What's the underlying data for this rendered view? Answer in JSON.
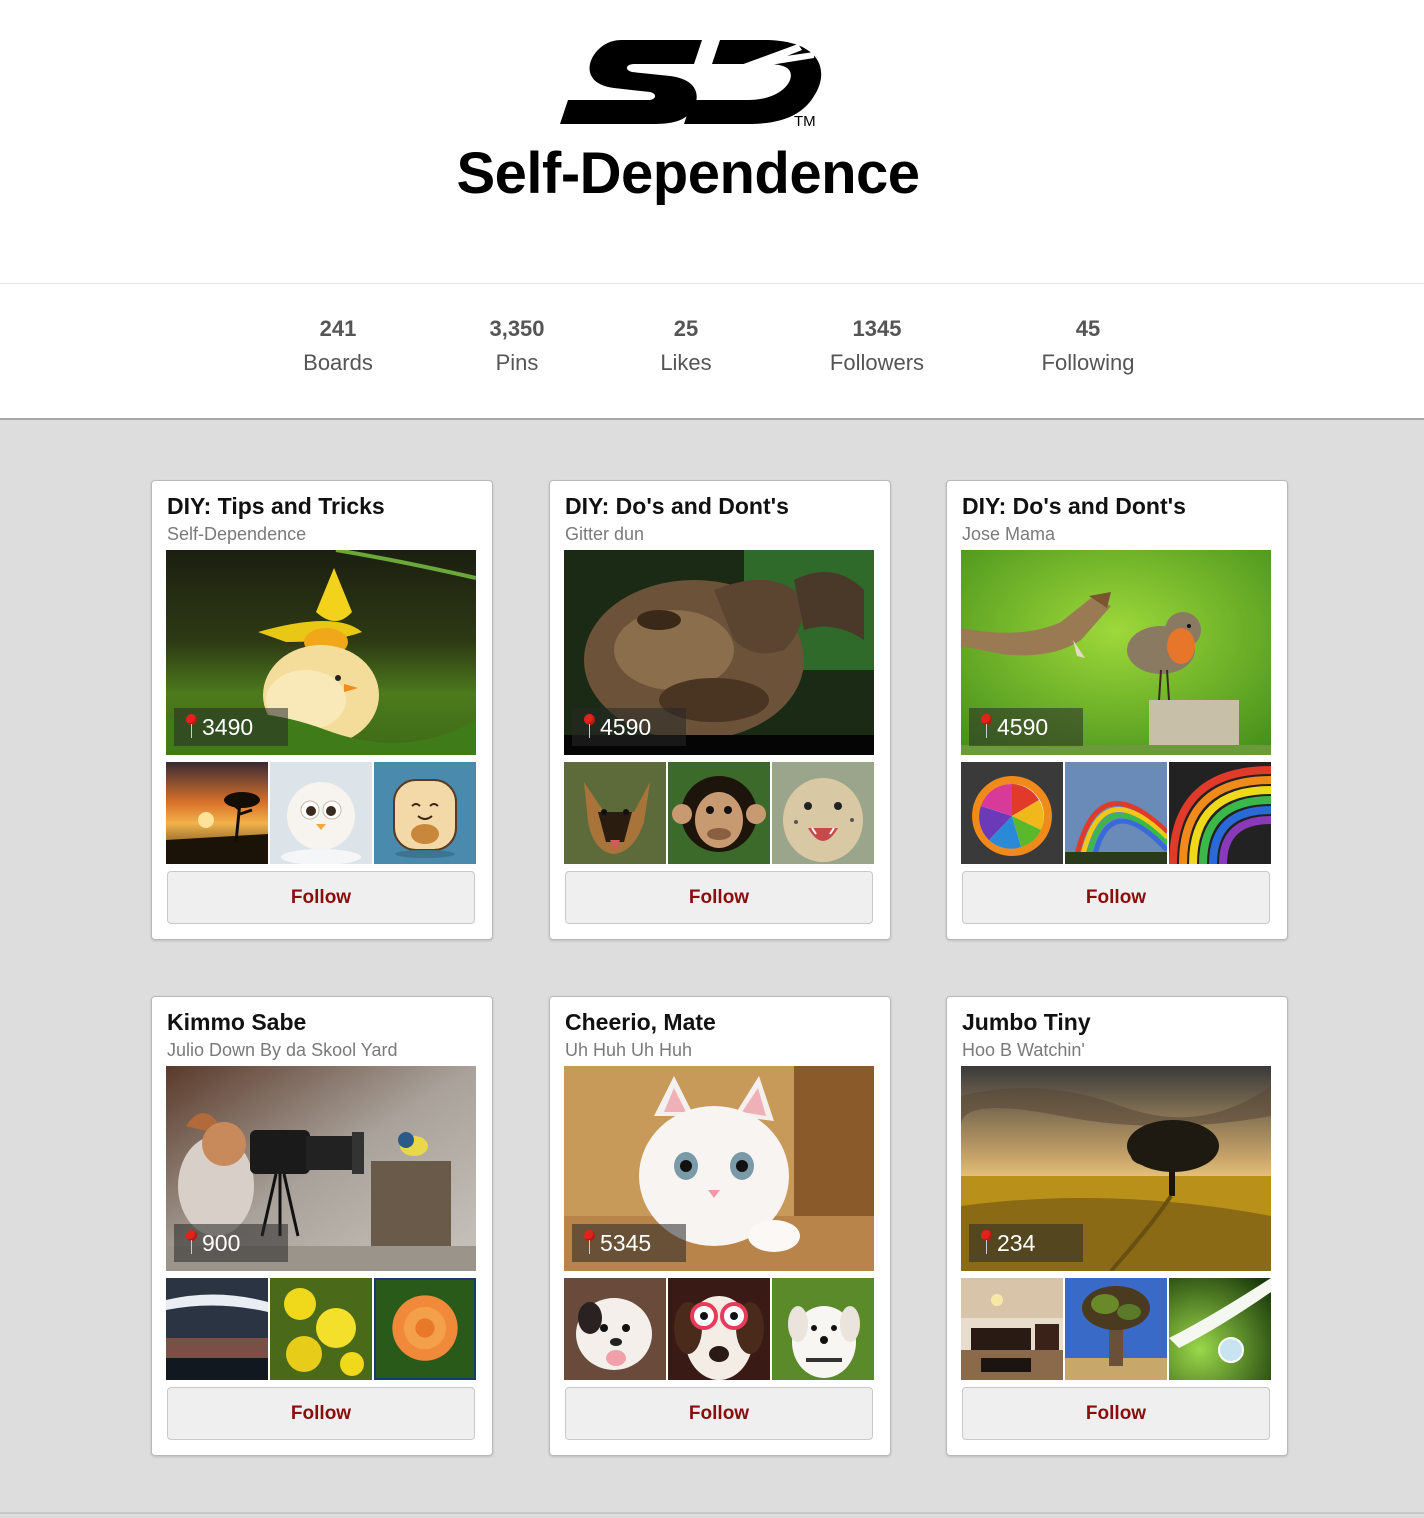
{
  "header": {
    "logo_text": "SD",
    "trademark": "TM",
    "title": "Self-Dependence"
  },
  "stats": [
    {
      "count": "241",
      "label": "Boards"
    },
    {
      "count": "3,350",
      "label": "Pins"
    },
    {
      "count": "25",
      "label": "Likes"
    },
    {
      "count": "1345",
      "label": "Followers"
    },
    {
      "count": "45",
      "label": "Following"
    }
  ],
  "boards": [
    {
      "title": "DIY: Tips and Tricks",
      "owner": "Self-Dependence",
      "pin_count": "3490",
      "cover": "chick-under-daffodil",
      "thumbnails": [
        "savanna-sunset",
        "fluffy-bird",
        "toast-character"
      ],
      "follow_label": "Follow"
    },
    {
      "title": "DIY: Do's and Dont's",
      "owner": "Gitter dun",
      "pin_count": "4590",
      "cover": "chimpanzee",
      "thumbnails": [
        "german-shepherd",
        "chimp-face",
        "cheetah-cub"
      ],
      "follow_label": "Follow"
    },
    {
      "title": "DIY: Do's and Dont's",
      "owner": "Jose Mama",
      "pin_count": "4590",
      "cover": "snake-and-robin",
      "thumbnails": [
        "rainbow-orange",
        "rainbow-arc",
        "rainbow-dark"
      ],
      "follow_label": "Follow"
    },
    {
      "title": "Kimmo Sabe",
      "owner": "Julio Down By da Skool Yard",
      "pin_count": "900",
      "cover": "squirrel-with-camera",
      "thumbnails": [
        "cloudy-sky",
        "yellow-flowers",
        "orange-rose"
      ],
      "follow_label": "Follow"
    },
    {
      "title": "Cheerio, Mate",
      "owner": "Uh Huh Uh Huh",
      "pin_count": "5345",
      "cover": "white-kitten",
      "thumbnails": [
        "puppy",
        "dog-with-glasses",
        "white-puppy"
      ],
      "follow_label": "Follow"
    },
    {
      "title": "Jumbo Tiny",
      "owner": "Hoo B Watchin'",
      "pin_count": "234",
      "cover": "tree-in-field",
      "thumbnails": [
        "living-room",
        "baobab-tree",
        "water-droplet"
      ],
      "follow_label": "Follow"
    }
  ],
  "colors": {
    "follow_text": "#8b0d0d",
    "grid_background": "#dddddd",
    "pin_icon": "#e2231a"
  }
}
